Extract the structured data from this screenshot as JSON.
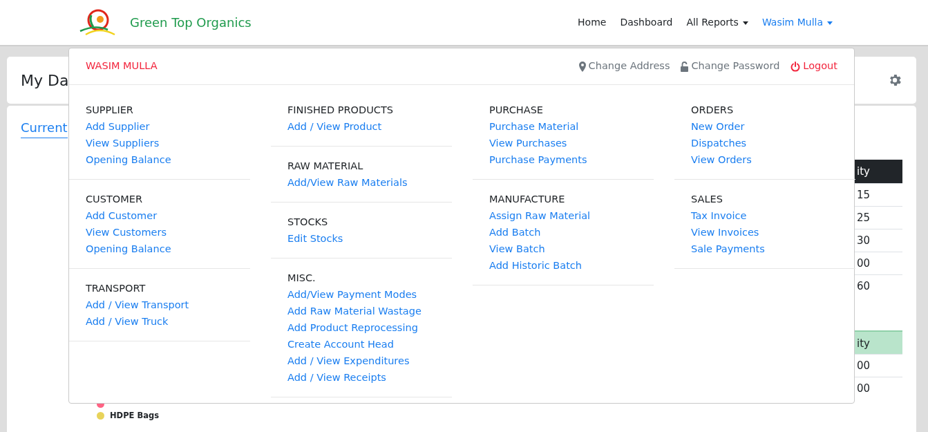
{
  "brand": {
    "name": "Green Top Organics"
  },
  "nav": [
    {
      "label": "Home",
      "dropdown": false,
      "open": false
    },
    {
      "label": "Dashboard",
      "dropdown": false,
      "open": false
    },
    {
      "label": "All Reports",
      "dropdown": true,
      "open": false
    },
    {
      "label": "Wasim Mulla",
      "dropdown": true,
      "open": true
    }
  ],
  "page": {
    "title": "My Da",
    "tabs": [
      {
        "label": "Current",
        "selected": true
      }
    ]
  },
  "tables": [
    {
      "header": "ity",
      "kind": "dark",
      "rows": [
        "15",
        "25",
        "30",
        "00",
        "60"
      ]
    },
    {
      "header": "ity",
      "kind": "success",
      "rows": [
        "00",
        "00"
      ]
    }
  ],
  "legend": [
    {
      "color": "#ff6384"
    },
    {
      "label": "HDPE Bags",
      "color": "#e8d35a"
    }
  ],
  "menu": {
    "user": "WASIM MULLA",
    "actions": [
      {
        "label": "Change Address",
        "kind": "address"
      },
      {
        "label": "Change Password",
        "kind": "password"
      },
      {
        "label": "Logout",
        "kind": "logout"
      }
    ],
    "columns": [
      [
        {
          "title": "SUPPLIER",
          "links": [
            "Add Supplier",
            "View Suppliers",
            "Opening Balance"
          ]
        },
        {
          "title": "CUSTOMER",
          "links": [
            "Add Customer",
            "View Customers",
            "Opening Balance"
          ]
        },
        {
          "title": "TRANSPORT",
          "links": [
            "Add / View Transport",
            "Add / View Truck"
          ]
        }
      ],
      [
        {
          "title": "FINISHED PRODUCTS",
          "links": [
            "Add / View Product"
          ]
        },
        {
          "title": "RAW MATERIAL",
          "links": [
            "Add/View Raw Materials"
          ]
        },
        {
          "title": "STOCKS",
          "links": [
            "Edit Stocks"
          ]
        },
        {
          "title": "MISC.",
          "links": [
            "Add/View Payment Modes",
            "Add Raw Material Wastage",
            "Add Product Reprocessing",
            "Create Account Head",
            "Add / View Expenditures",
            "Add / View Receipts"
          ]
        }
      ],
      [
        {
          "title": "PURCHASE",
          "links": [
            "Purchase Material",
            "View Purchases",
            "Purchase Payments"
          ]
        },
        {
          "title": "MANUFACTURE",
          "links": [
            "Assign Raw Material",
            "Add Batch",
            "View Batch",
            "Add Historic Batch"
          ]
        }
      ],
      [
        {
          "title": "ORDERS",
          "links": [
            "New Order",
            "Dispatches",
            "View Orders"
          ]
        },
        {
          "title": "SALES",
          "links": [
            "Tax Invoice",
            "View Invoices",
            "Sale Payments"
          ]
        }
      ]
    ]
  }
}
